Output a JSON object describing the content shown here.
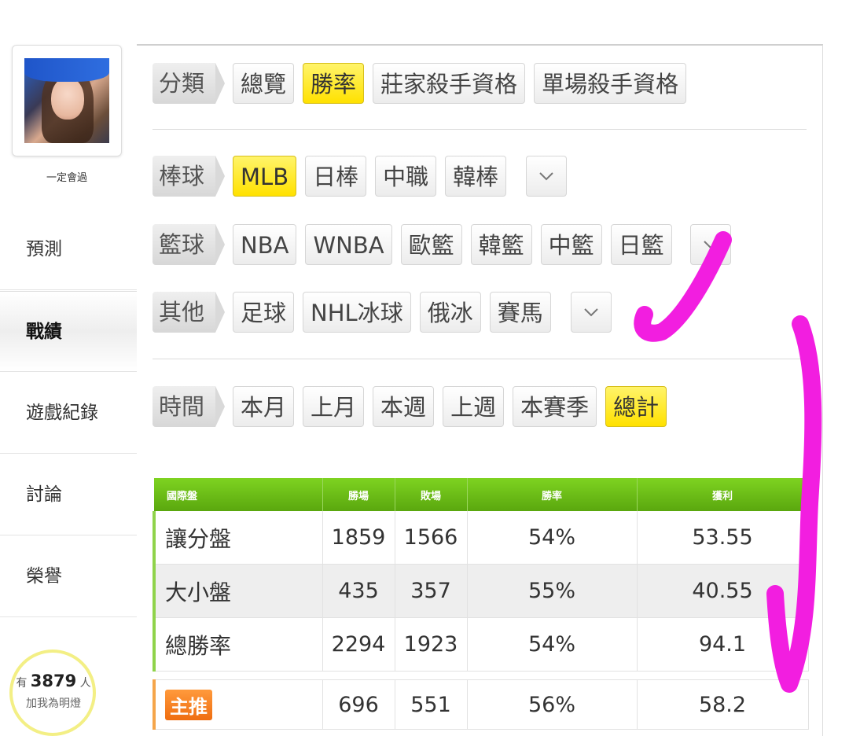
{
  "sidebar": {
    "username": "一定會過",
    "nav": [
      "預測",
      "戰績",
      "遊戲紀錄",
      "討論",
      "榮譽"
    ],
    "active_index": 1,
    "fans": {
      "prefix": "有",
      "count": "3879",
      "suffix": "人",
      "action": "加我為明燈"
    }
  },
  "filters": {
    "category": {
      "label": "分類",
      "options": [
        "總覽",
        "勝率",
        "莊家殺手資格",
        "單場殺手資格"
      ],
      "selected": "勝率"
    },
    "baseball": {
      "label": "棒球",
      "options": [
        "MLB",
        "日棒",
        "中職",
        "韓棒"
      ],
      "selected": "MLB"
    },
    "basketball": {
      "label": "籃球",
      "options": [
        "NBA",
        "WNBA",
        "歐籃",
        "韓籃",
        "中籃",
        "日籃"
      ]
    },
    "other": {
      "label": "其他",
      "options": [
        "足球",
        "NHL冰球",
        "俄冰",
        "賽馬"
      ]
    },
    "time": {
      "label": "時間",
      "options": [
        "本月",
        "上月",
        "本週",
        "上週",
        "本賽季",
        "總計"
      ],
      "selected": "總計"
    }
  },
  "stats": {
    "headers": [
      "國際盤",
      "勝場",
      "敗場",
      "勝率",
      "獲利"
    ],
    "rows": [
      [
        "讓分盤",
        "1859",
        "1566",
        "54%",
        "53.55"
      ],
      [
        "大小盤",
        "435",
        "357",
        "55%",
        "40.55"
      ],
      [
        "總勝率",
        "2294",
        "1923",
        "54%",
        "94.1"
      ]
    ],
    "pick": {
      "label": "主推",
      "wins": "696",
      "losses": "551",
      "rate": "56%",
      "profit": "58.2"
    }
  },
  "colors": {
    "selected_chip": "#ffe100",
    "table_header": "#6cbf18",
    "annotation": "#f21ee0",
    "pick_badge": "#ef6d10"
  },
  "icons": {
    "dropdown": "chevron-down-icon"
  }
}
